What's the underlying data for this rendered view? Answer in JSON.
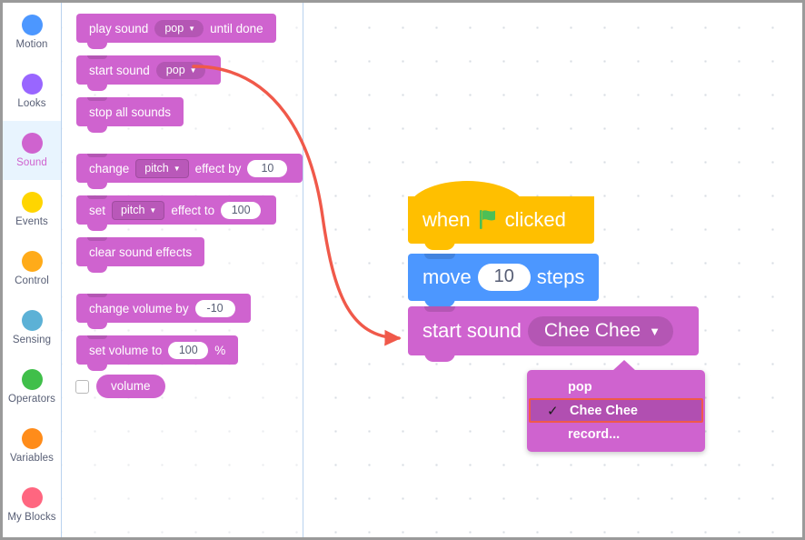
{
  "theme": {
    "sound_color": "#cf63cf",
    "motion_color": "#4c97ff",
    "event_color": "#ffbf00",
    "annotation_color": "#f0594a",
    "active_category_bg": "#e8f4fe",
    "active_category_text": "#cf63cf"
  },
  "sidebar": {
    "items": [
      {
        "label": "Motion",
        "color": "#4c97ff",
        "active": false,
        "icon": "motion-dot-icon"
      },
      {
        "label": "Looks",
        "color": "#9966ff",
        "active": false,
        "icon": "looks-dot-icon"
      },
      {
        "label": "Sound",
        "color": "#cf63cf",
        "active": true,
        "icon": "sound-dot-icon"
      },
      {
        "label": "Events",
        "color": "#ffd500",
        "active": false,
        "icon": "events-dot-icon"
      },
      {
        "label": "Control",
        "color": "#ffab19",
        "active": false,
        "icon": "control-dot-icon"
      },
      {
        "label": "Sensing",
        "color": "#5cb1d6",
        "active": false,
        "icon": "sensing-dot-icon"
      },
      {
        "label": "Operators",
        "color": "#40bf4a",
        "active": false,
        "icon": "operators-dot-icon"
      },
      {
        "label": "Variables",
        "color": "#ff8c1a",
        "active": false,
        "icon": "variables-dot-icon"
      },
      {
        "label": "My Blocks",
        "color": "#ff6680",
        "active": false,
        "icon": "myblocks-dot-icon"
      }
    ]
  },
  "palette": {
    "play_sound": {
      "pre": "play sound",
      "dropdown": "pop",
      "post": "until done"
    },
    "start_sound": {
      "pre": "start sound",
      "dropdown": "pop"
    },
    "stop_all_sounds": {
      "label": "stop all sounds"
    },
    "change_effect": {
      "pre": "change",
      "dropdown": "pitch",
      "mid": "effect by",
      "value": "10"
    },
    "set_effect": {
      "pre": "set",
      "dropdown": "pitch",
      "mid": "effect to",
      "value": "100"
    },
    "clear_effects": {
      "label": "clear sound effects"
    },
    "change_volume": {
      "pre": "change volume by",
      "value": "-10"
    },
    "set_volume": {
      "pre": "set volume to",
      "value": "100",
      "post": "%"
    },
    "volume_reporter": {
      "label": "volume",
      "checked": false
    }
  },
  "script": {
    "when_flag_clicked": {
      "pre": "when",
      "flag": "green-flag-icon",
      "post": "clicked"
    },
    "move_steps": {
      "pre": "move",
      "value": "10",
      "post": "steps"
    },
    "start_sound": {
      "pre": "start sound",
      "dropdown": "Chee Chee"
    }
  },
  "dropdown_menu": {
    "open": true,
    "selected": "Chee Chee",
    "items": [
      {
        "label": "pop",
        "selected": false,
        "check": ""
      },
      {
        "label": "Chee Chee",
        "selected": true,
        "check": "✓"
      },
      {
        "label": "record...",
        "selected": false,
        "check": ""
      }
    ]
  },
  "annotation": {
    "type": "curved-arrow",
    "color": "#f0594a",
    "from": "start sound pop (palette)",
    "to": "start sound Chee Chee (script)"
  }
}
